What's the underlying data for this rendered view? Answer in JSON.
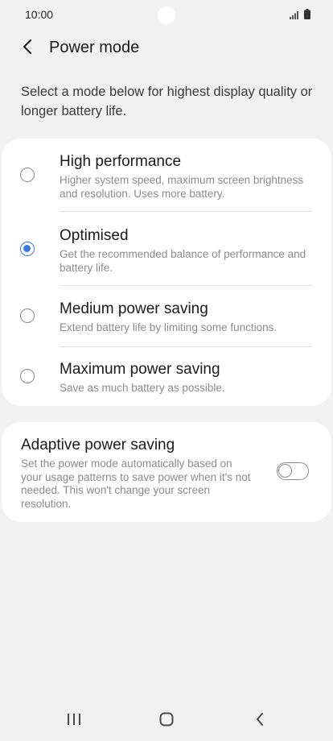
{
  "status_bar": {
    "time": "10:00"
  },
  "header": {
    "title": "Power mode"
  },
  "description": "Select a mode below for highest display quality or longer battery life.",
  "modes": [
    {
      "title": "High performance",
      "description": "Higher system speed, maximum screen brightness and resolution. Uses more battery.",
      "selected": false
    },
    {
      "title": "Optimised",
      "description": "Get the recommended balance of performance and battery life.",
      "selected": true
    },
    {
      "title": "Medium power saving",
      "description": "Extend battery life by limiting some functions.",
      "selected": false
    },
    {
      "title": "Maximum power saving",
      "description": "Save as much battery as possible.",
      "selected": false
    }
  ],
  "adaptive": {
    "title": "Adaptive power saving",
    "description": "Set the power mode automatically based on your usage patterns to save power when it's not needed. This won't change your screen resolution.",
    "enabled": false
  },
  "colors": {
    "accent": "#3e7ad3",
    "background": "#f1f1f1",
    "card": "#ffffff",
    "secondary_text": "#8b8b8b"
  },
  "icons": {
    "back": "chevron-left-icon",
    "signal": "signal-icon",
    "battery": "battery-icon",
    "nav_recent": "recent-apps-icon",
    "nav_home": "home-icon",
    "nav_back": "back-icon"
  }
}
